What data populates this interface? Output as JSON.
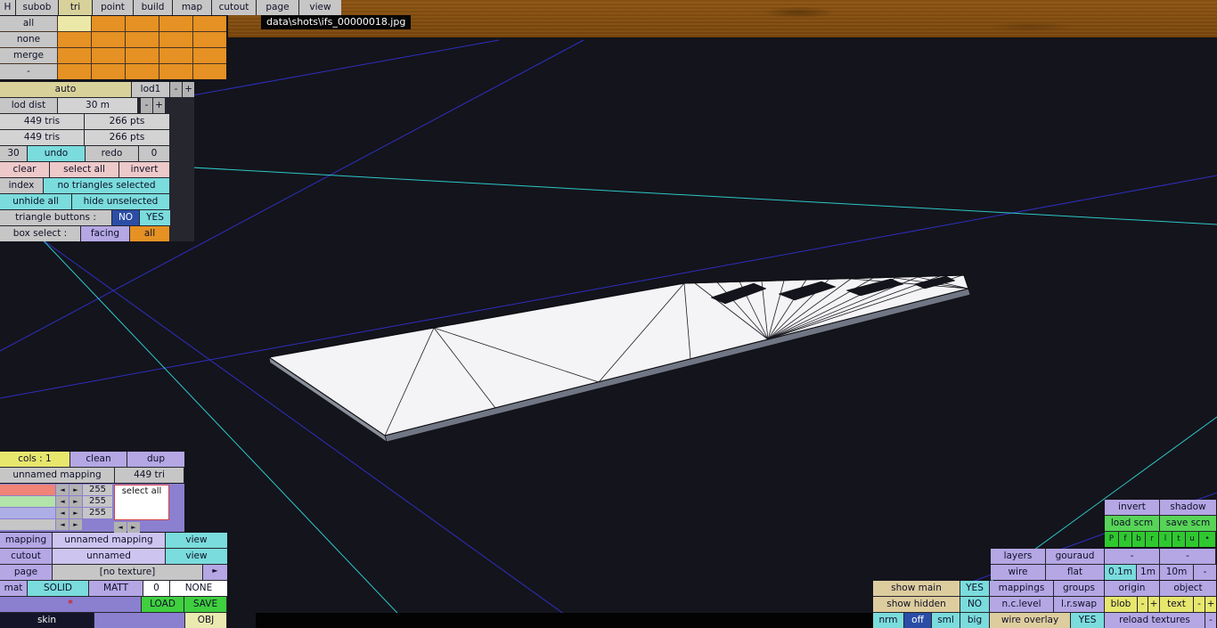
{
  "colors": {
    "viewport_bg": "#14141c",
    "grid_blue": "#3333dd",
    "grid_cyan": "#30dcdc",
    "accent_orange": "#e59123",
    "accent_aqua": "#7adcdc",
    "accent_lavender": "#b4a7e4",
    "accent_green": "#3fcf3f",
    "selected_navy": "#2b4da6"
  },
  "titlebar": {
    "path": "data\\shots\\ifs_00000018.jpg"
  },
  "tabs": {
    "items": [
      "H",
      "subob",
      "tri",
      "point",
      "build",
      "map",
      "cutout",
      "page",
      "view"
    ],
    "active": "tri"
  },
  "subobject_grid": {
    "row_labels": [
      "all",
      "none",
      "merge",
      "-"
    ]
  },
  "lod": {
    "auto": "auto",
    "lod_name": "lod1",
    "minus": "-",
    "plus": "+",
    "dist_label": "lod dist",
    "dist_value": "30 m",
    "tris_total": "449 tris",
    "pts_total": "266 pts",
    "tris_lod": "449 tris",
    "pts_lod": "266 pts",
    "undo_count": "30",
    "undo": "undo",
    "redo": "redo",
    "redo_count": "0",
    "clear": "clear",
    "select_all": "select all",
    "invert": "invert",
    "index": "index",
    "selection_status": "no triangles selected",
    "unhide_all": "unhide all",
    "hide_unselected": "hide unselected",
    "triangle_buttons_label": "triangle buttons :",
    "triangle_no": "NO",
    "triangle_yes": "YES",
    "box_select_label": "box select :",
    "box_facing": "facing",
    "box_all": "all"
  },
  "mapping": {
    "cols_btn": "cols : 1",
    "clean": "clean",
    "dup": "dup",
    "name": "unnamed mapping",
    "tri_count": "449 tri",
    "arrow_left": "◄",
    "arrow_right": "►",
    "channels": [
      {
        "swatch": "#f08476",
        "value": "255"
      },
      {
        "swatch": "#b2e3aa",
        "value": "255"
      },
      {
        "swatch": "#aeaee6",
        "value": "255"
      },
      {
        "swatch": "#c6c6c6",
        "value": ""
      }
    ],
    "list_item": "select all",
    "rows": {
      "mapping_label": "mapping",
      "mapping_value": "unnamed mapping",
      "mapping_view": "view",
      "cutout_label": "cutout",
      "cutout_value": "unnamed",
      "cutout_view": "view",
      "page_label": "page",
      "page_value": "[no texture]",
      "page_browse": "►",
      "mat_label": "mat",
      "mat_solid": "SOLID",
      "mat_matt": "MATT",
      "mat_zero": "0",
      "mat_none": "NONE",
      "dirty_star": "*",
      "load": "LOAD",
      "save": "SAVE",
      "skin": "skin",
      "obj": "OBJ"
    }
  },
  "right": {
    "invert": "invert",
    "shadow": "shadow",
    "load_scm": "load scm",
    "save_scm": "save scm",
    "view_keys": [
      "P",
      "f",
      "b",
      "r",
      "l",
      "t",
      "u",
      "•"
    ],
    "layers": "layers",
    "gouraud": "gouraud",
    "layers_dash1": "-",
    "layers_dash2": "-",
    "wire": "wire",
    "flat": "flat",
    "grid_01m": "0.1m",
    "grid_1m": "1m",
    "grid_10m": "10m",
    "grid_dash": "-",
    "show_main": "show main",
    "show_main_val": "YES",
    "mappings": "mappings",
    "groups": "groups",
    "origin": "origin",
    "object": "object",
    "show_hidden": "show hidden",
    "show_hidden_val": "NO",
    "nc_level": "n.c.level",
    "lr_swap": "l.r.swap",
    "blob": "blob",
    "blob_minus": "-",
    "blob_plus": "+",
    "text": "text",
    "text_minus": "-",
    "text_plus": "+",
    "nrm": "nrm",
    "nrm_off": "off",
    "nrm_sml": "sml",
    "nrm_big": "big",
    "wire_overlay": "wire overlay",
    "wire_overlay_val": "YES",
    "reload_textures": "reload textures",
    "reload_dash": "-"
  }
}
